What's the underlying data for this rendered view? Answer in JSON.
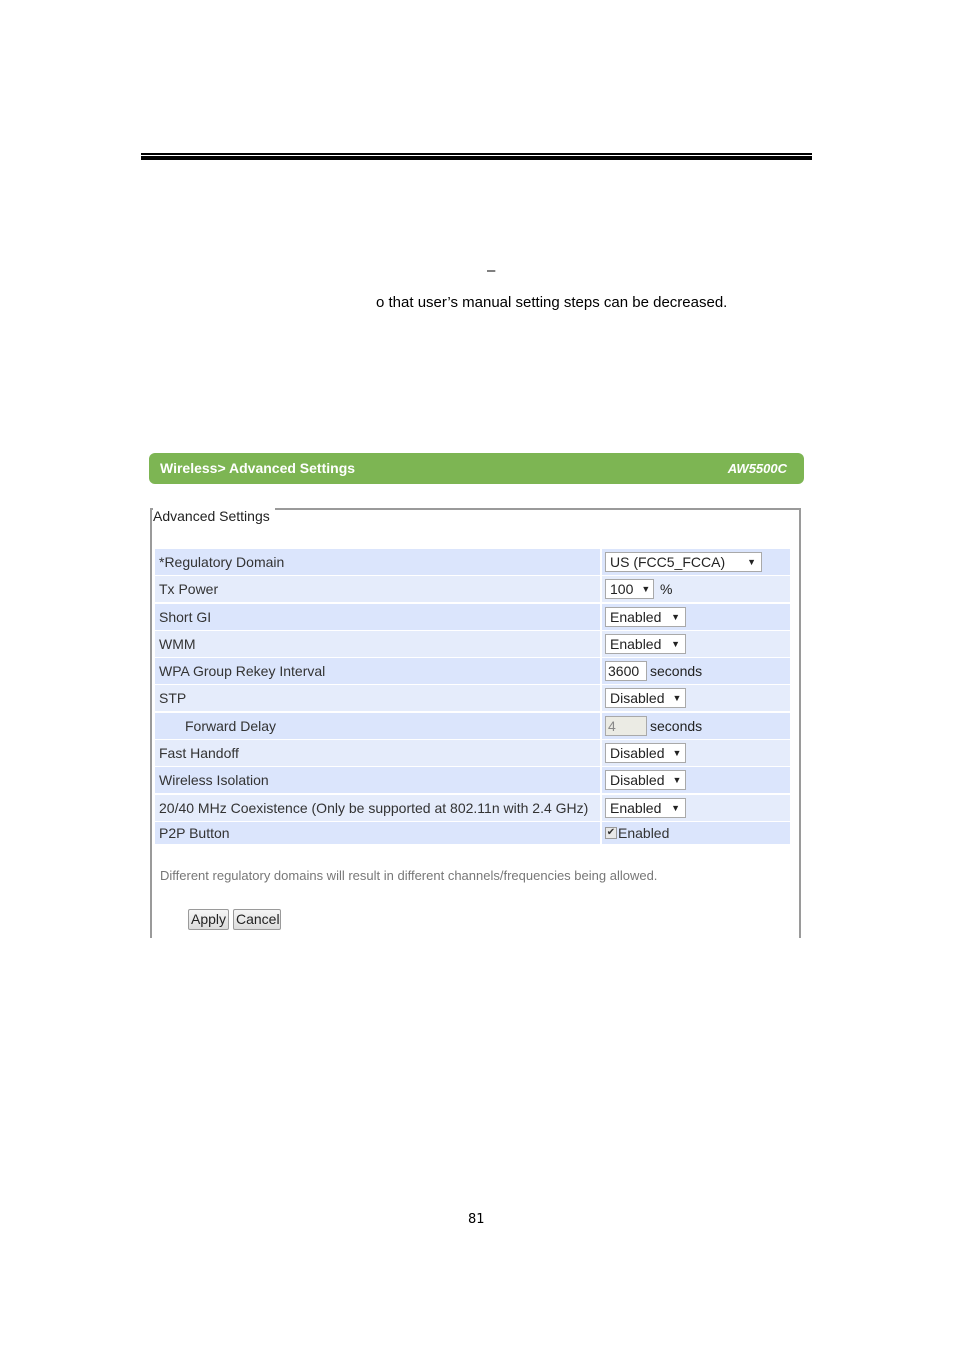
{
  "document": {
    "dash": "–",
    "body_line": "o that user’s manual setting steps can be decreased.",
    "page_number": "81"
  },
  "panel": {
    "breadcrumb": "Wireless> Advanced Settings",
    "model": "AW5500C",
    "header_color": "#7db553",
    "fieldset_legend": "Advanced Settings"
  },
  "settings": [
    {
      "label": "*Regulatory Domain",
      "type": "select",
      "value": "US (FCC5_FCCA)"
    },
    {
      "label": "Tx Power",
      "type": "select",
      "value": "100",
      "unit": "%"
    },
    {
      "label": "Short GI",
      "type": "select",
      "value": "Enabled"
    },
    {
      "label": "WMM",
      "type": "select",
      "value": "Enabled"
    },
    {
      "label": "WPA Group Rekey Interval",
      "type": "input",
      "value": "3600",
      "unit": "seconds"
    },
    {
      "label": "STP",
      "type": "select",
      "value": "Disabled"
    },
    {
      "label": "Forward Delay",
      "type": "input-disabled",
      "value": "4",
      "unit": "seconds"
    },
    {
      "label": "Fast Handoff",
      "type": "select",
      "value": "Disabled"
    },
    {
      "label": "Wireless Isolation",
      "type": "select",
      "value": "Disabled"
    },
    {
      "label": "20/40 MHz Coexistence (Only be supported at 802.11n with 2.4 GHz)",
      "type": "select",
      "value": "Enabled"
    },
    {
      "label": "P2P Button",
      "type": "checkbox",
      "checked": true,
      "value": "Enabled"
    }
  ],
  "note": "Different regulatory domains will result in different channels/frequencies being allowed.",
  "buttons": {
    "apply": "Apply",
    "cancel": "Cancel"
  },
  "icons": {
    "dropdown": "▼",
    "check": "✔"
  }
}
